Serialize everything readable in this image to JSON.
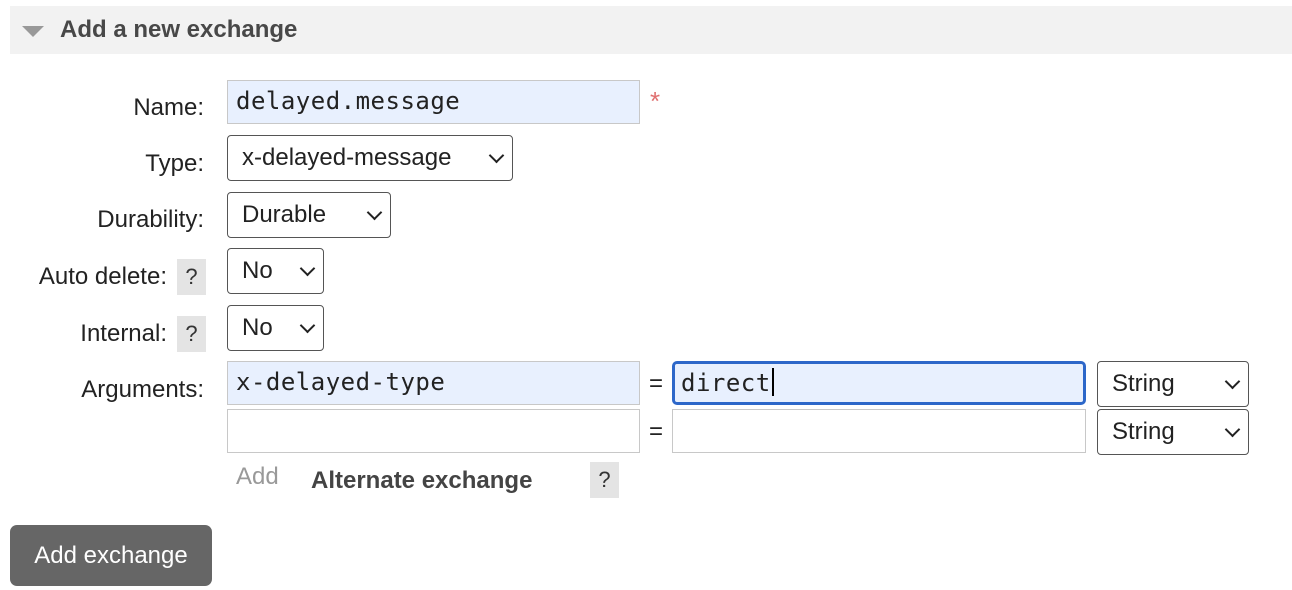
{
  "section": {
    "title": "Add a new exchange",
    "collapse_icon": "caret-down-icon"
  },
  "form": {
    "name": {
      "label": "Name:",
      "value": "delayed.message",
      "required_marker": "*"
    },
    "type": {
      "label": "Type:",
      "value": "x-delayed-message"
    },
    "durability": {
      "label": "Durability:",
      "value": "Durable"
    },
    "auto_delete": {
      "label": "Auto delete:",
      "help": "?",
      "value": "No"
    },
    "internal": {
      "label": "Internal:",
      "help": "?",
      "value": "No"
    },
    "arguments": {
      "label": "Arguments:",
      "rows": [
        {
          "key": "x-delayed-type",
          "equals": "=",
          "value": "direct",
          "type": "String"
        },
        {
          "key": "",
          "equals": "=",
          "value": "",
          "type": "String"
        }
      ],
      "add_label": "Add",
      "alternate_exchange_label": "Alternate exchange",
      "alternate_exchange_help": "?"
    }
  },
  "actions": {
    "submit_label": "Add exchange"
  },
  "colors": {
    "header_bg": "#f2f2f2",
    "autofill_bg": "#e8f0fe",
    "focus_border": "#2d67c9",
    "required": "#e07070",
    "button_bg": "#666666"
  }
}
